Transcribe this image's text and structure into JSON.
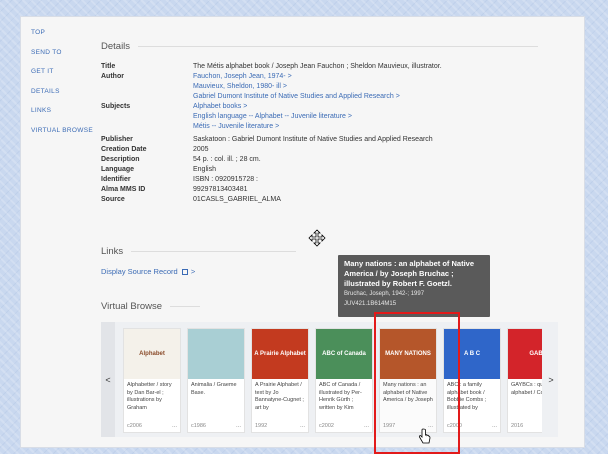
{
  "nav": [
    "TOP",
    "SEND TO",
    "GET IT",
    "DETAILS",
    "LINKS",
    "VIRTUAL BROWSE"
  ],
  "details": {
    "heading": "Details",
    "title_label": "Title",
    "title": "The Métis alphabet book / Joseph Jean Fauchon ; Sheldon Mauvieux, illustrator.",
    "author_label": "Author",
    "authors": [
      "Fauchon, Joseph Jean, 1974-  >",
      "Mauvieux, Sheldon, 1980- ill  >",
      "Gabriel Dumont Institute of Native Studies and Applied Research  >"
    ],
    "subjects_label": "Subjects",
    "subjects": [
      "Alphabet books  >",
      "English language -- Alphabet -- Juvenile literature  >",
      "Métis -- Juvenile literature  >"
    ],
    "publisher_label": "Publisher",
    "publisher": "Saskatoon : Gabriel Dumont Institute of Native Studies and Applied Research",
    "creation_label": "Creation Date",
    "creation": "2005",
    "description_label": "Description",
    "description": "54 p. : col. ill. ; 28 cm.",
    "language_label": "Language",
    "language": "English",
    "identifier_label": "Identifier",
    "identifier": "ISBN : 0920915728 :",
    "mms_label": "Alma MMS ID",
    "mms": "99297813403481",
    "source_label": "Source",
    "source": "01CASLS_GABRIEL_ALMA"
  },
  "links": {
    "heading": "Links",
    "display_source": "Display Source Record",
    "arrow": ">"
  },
  "virtual_browse": {
    "heading": "Virtual Browse",
    "prev": "<",
    "next": ">",
    "cards": [
      {
        "cover_text": "Alphabet",
        "color": "#f4f1ea",
        "text": "Alphabetter / story by Dan Bar-el ; illustrations by Graham",
        "year": "c2006"
      },
      {
        "cover_text": "",
        "color": "#a9cfd4",
        "text": "Animalia / Graeme Base.",
        "year": "c1986"
      },
      {
        "cover_text": "A Prairie Alphabet",
        "color": "#c33a1f",
        "text": "A Prairie Alphabet / text by Jo Bannatyne-Cugnet ; art by",
        "year": "1992"
      },
      {
        "cover_text": "ABC of Canada",
        "color": "#4b8f5a",
        "text": "ABC of Canada / illustrated by Per-Henrik Gürth ; written by Kim",
        "year": "c2002"
      },
      {
        "cover_text": "MANY NATIONS",
        "color": "#b5562a",
        "text": "Many nations : an alphabet of Native America / by Joseph",
        "year": "1997"
      },
      {
        "cover_text": "A B C",
        "color": "#2f66c9",
        "text": "ABC : a family alphabet book / Bobbie Combs ; illustrated by",
        "year": "c2000"
      },
      {
        "cover_text": "GAB",
        "color": "#d3242a",
        "text": "GAYBCs : queer alphabet / Congdon",
        "year": "2016"
      }
    ]
  },
  "tooltip": {
    "title": "Many nations : an alphabet of Native America / by Joseph Bruchac ; illustrated by Robert F. Goetzl.",
    "author": "Bruchac, Joseph, 1942-; 1997",
    "call": "JUV421.1B614M15"
  },
  "colors": {
    "link": "#3b6bb5",
    "highlight": "#e21a1a",
    "tooltip_bg": "#5a5a5a"
  }
}
